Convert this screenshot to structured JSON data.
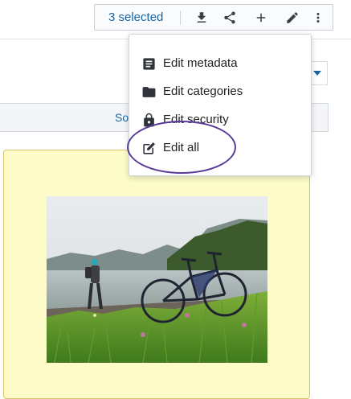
{
  "toolbar": {
    "selected_text": "3 selected",
    "icons": [
      "download-icon",
      "share-icon",
      "add-icon",
      "edit-icon",
      "more-vert-icon"
    ]
  },
  "sort": {
    "label": "So"
  },
  "menu": {
    "items": [
      {
        "label": "Edit metadata",
        "icon": "metadata-icon"
      },
      {
        "label": "Edit categories",
        "icon": "folder-icon"
      },
      {
        "label": "Edit security",
        "icon": "lock-icon"
      },
      {
        "label": "Edit all",
        "icon": "edit-square-icon"
      }
    ]
  },
  "colors": {
    "accent": "#1766a8",
    "card_bg": "#fdfcc8",
    "highlight_ring": "#5a3b9a"
  }
}
